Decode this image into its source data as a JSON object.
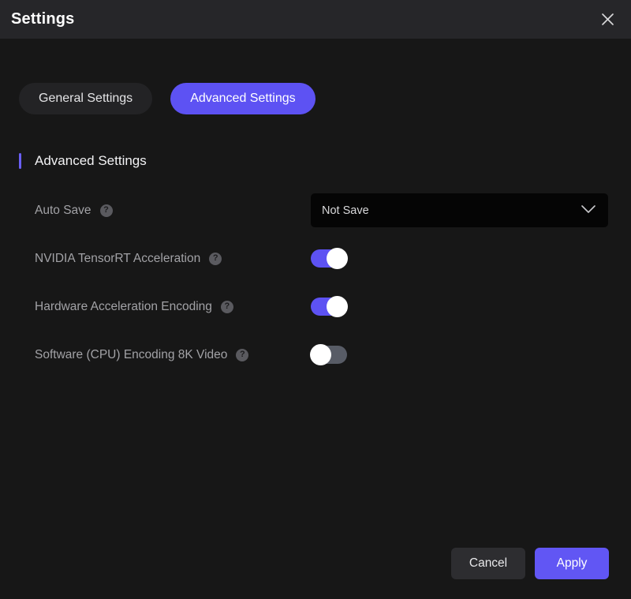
{
  "window": {
    "title": "Settings",
    "close_icon": "close-icon"
  },
  "tabs": [
    {
      "label": "General Settings",
      "active": false
    },
    {
      "label": "Advanced Settings",
      "active": true
    }
  ],
  "section": {
    "title": "Advanced Settings",
    "accent_color": "#6a5ff5"
  },
  "settings": {
    "auto_save": {
      "label": "Auto Save",
      "help_icon": "help-icon",
      "control": "dropdown",
      "value": "Not Save",
      "chevron_icon": "chevron-down-icon"
    },
    "tensorrt": {
      "label": "NVIDIA TensorRT Acceleration",
      "help_icon": "help-icon",
      "control": "toggle",
      "state": "on"
    },
    "hardware_encoding": {
      "label": "Hardware Acceleration Encoding",
      "help_icon": "help-icon",
      "control": "toggle",
      "state": "on"
    },
    "software_8k": {
      "label": "Software (CPU) Encoding 8K Video",
      "help_icon": "help-icon",
      "control": "toggle",
      "state": "off"
    }
  },
  "footer": {
    "cancel_label": "Cancel",
    "apply_label": "Apply"
  },
  "colors": {
    "accent": "#5d52f3",
    "titlebar_bg": "#262629",
    "body_bg": "#171717",
    "field_bg": "#050505",
    "toggle_off": "#585c66"
  },
  "glyphs": {
    "question_mark": "?"
  }
}
